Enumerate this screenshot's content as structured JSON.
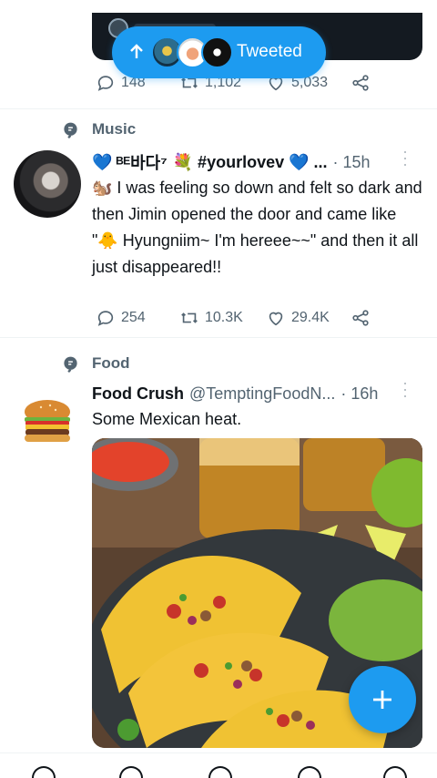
{
  "top_tweet": {
    "toast_label": "Tweeted",
    "stats": {
      "replies": "148",
      "retweets": "1,102",
      "likes": "5,033"
    }
  },
  "music_tweet": {
    "context": "Music",
    "author_prefix": "💙",
    "author_name": "ᴮᴱ바다⁷",
    "author_suffix": "💐 #yourlovev 💙 ...",
    "time": "· 15h",
    "text": "🐿️ I was feeling so down and felt so dark and then Jimin opened the door and came like \"🐥 Hyungniim~ I'm hereee~~\" and then it all just disappeared!!",
    "stats": {
      "replies": "254",
      "retweets": "10.3K",
      "likes": "29.4K"
    }
  },
  "food_tweet": {
    "context": "Food",
    "author_name": "Food Crush",
    "handle": "@TemptingFoodN...",
    "time": "· 16h",
    "text": "Some Mexican heat.",
    "image_icon": "tacos-photo"
  },
  "fab": {
    "icon": "plus-icon"
  },
  "colors": {
    "accent": "#1d9bf0",
    "muted": "#536471",
    "text": "#0f1419"
  }
}
